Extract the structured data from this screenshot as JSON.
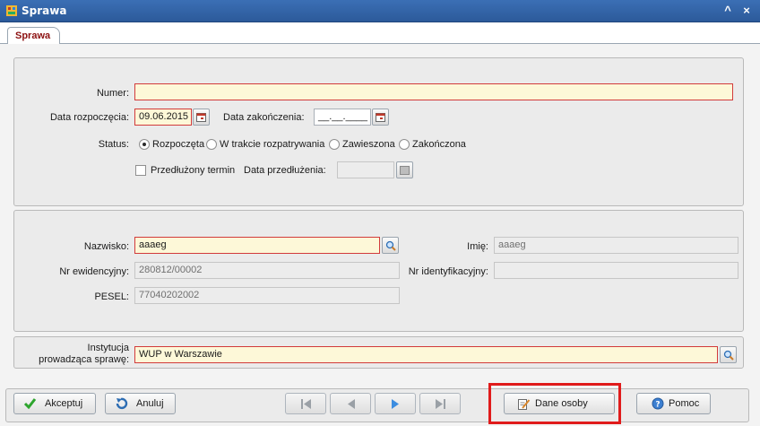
{
  "window": {
    "title": "Sprawa",
    "minimize": "^",
    "close": "×"
  },
  "tabs": [
    {
      "label": "Sprawa"
    }
  ],
  "case": {
    "numer_label": "Numer:",
    "numer_value": "",
    "data_rozp_label": "Data rozpoczęcia:",
    "data_rozp_value": "09.06.2015",
    "data_zak_label": "Data zakończenia:",
    "data_zak_value": "__.__.____",
    "status_label": "Status:",
    "status_options": [
      "Rozpoczęta",
      "W trakcie rozpatrywania",
      "Zawieszona",
      "Zakończona"
    ],
    "status_selected": "Rozpoczęta",
    "przedluzony_label": "Przedłużony termin",
    "przedluzony_checked": false,
    "data_przedl_label": "Data przedłużenia:",
    "data_przedl_value": ""
  },
  "person": {
    "nazwisko_label": "Nazwisko:",
    "nazwisko_value": "aaaeg",
    "imie_label": "Imię:",
    "imie_value": "aaaeg",
    "nr_ewid_label": "Nr ewidencyjny:",
    "nr_ewid_value": "280812/00002",
    "nr_ident_label": "Nr identyfikacyjny:",
    "nr_ident_value": "",
    "pesel_label": "PESEL:",
    "pesel_value": "77040202002"
  },
  "institution": {
    "label_line1": "Instytucja",
    "label_line2": "prowadząca sprawę:",
    "value": "WUP w Warszawie"
  },
  "footer": {
    "accept_label": "Akceptuj",
    "cancel_label": "Anuluj",
    "person_data_label": "Dane osoby",
    "help_label": "Pomoc"
  },
  "colors": {
    "titlebar": "#2c5a9a",
    "required_bg": "#fdf8d8",
    "required_border": "#d23b3b",
    "tab_text": "#8c1010",
    "highlight": "#e01b1b"
  },
  "icons": {
    "app": "app-icon",
    "calendar": "calendar-icon",
    "search": "magnifier-icon",
    "accept": "checkmark-icon",
    "cancel": "undo-icon",
    "person_data": "edit-document-icon",
    "help": "help-icon",
    "nav": [
      "first-record-icon",
      "previous-record-icon",
      "next-record-icon",
      "last-record-icon"
    ]
  }
}
